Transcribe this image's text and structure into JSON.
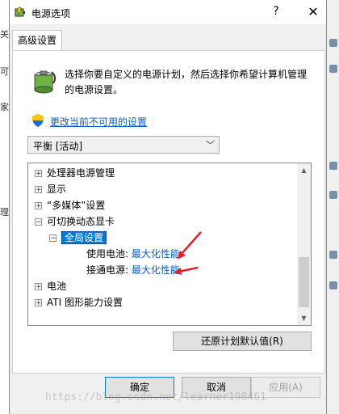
{
  "window": {
    "title": "电源选项",
    "help_label": "?",
    "close_label": "✕"
  },
  "tabs": [
    {
      "label": "高级设置"
    }
  ],
  "description": "选择你要自定义的电源计划，然后选择你希望计算机管理的电源设置。",
  "change_link": "更改当前不可用的设置",
  "plan_select": {
    "value": "平衡 [活动]"
  },
  "tree": {
    "items": [
      {
        "label": "处理器电源管理",
        "expander": "+"
      },
      {
        "label": "显示",
        "expander": "+"
      },
      {
        "label": "“多媒体”设置",
        "expander": "+"
      },
      {
        "label": "可切换动态显卡",
        "expander": "−"
      },
      {
        "label": "全局设置",
        "expander": "−"
      },
      {
        "label": "使用电池:",
        "value": "最大化性能"
      },
      {
        "label": "接通电源:",
        "value": "最大化性能"
      },
      {
        "label": "电池",
        "expander": "+"
      },
      {
        "label": "ATI 图形能力设置",
        "expander": "+"
      }
    ]
  },
  "restore_button": "还原计划默认值(R)",
  "buttons": {
    "ok": "确定",
    "cancel": "取消",
    "apply": "应用(A)"
  },
  "background_left": [
    "关",
    "可",
    "家",
    "理"
  ],
  "watermark": "https://blog.csdn.net/learner198461",
  "colors": {
    "accent": "#0078d7",
    "link": "#0a5ec8",
    "annotation_arrow": "#e8202a"
  }
}
